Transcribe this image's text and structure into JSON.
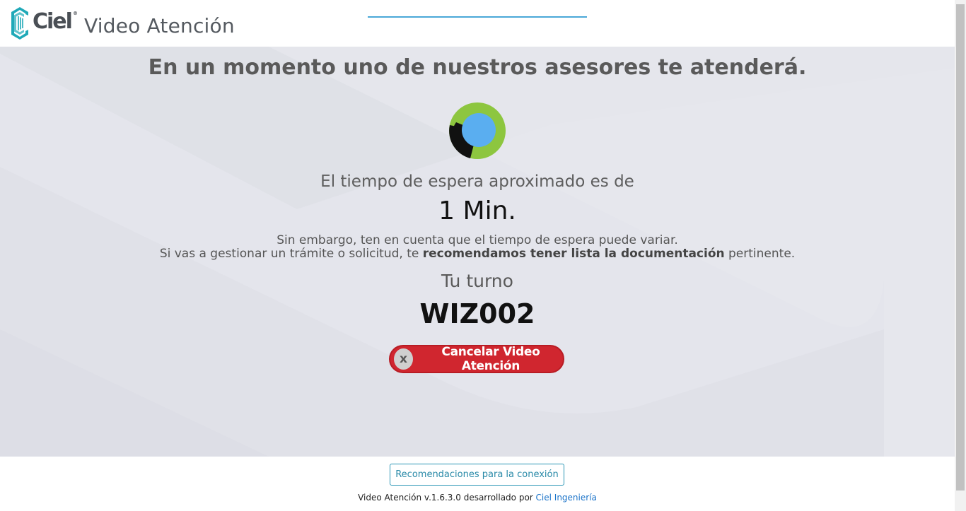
{
  "header": {
    "logo_text": "Ciel",
    "logo_reg": "®",
    "app_title": "Video Atención"
  },
  "main": {
    "headline": "En un momento uno de nuestros asesores te atenderá.",
    "spinner_icon": "loading-spinner-icon",
    "wait_label": "El tiempo de espera aproximado es de",
    "wait_value": "1 Min.",
    "note_line1": "Sin embargo, ten en cuenta que el tiempo de espera puede variar.",
    "note_line2_pre": "Si vas a gestionar un trámite o solicitud, te ",
    "note_line2_bold": "recomendamos tener lista la documentación",
    "note_line2_post": " pertinente.",
    "turn_label": "Tu turno",
    "turn_value": "WIZ002",
    "cancel_button": {
      "label": "Cancelar Video Atención",
      "icon_glyph": "x"
    }
  },
  "footer": {
    "recommendations_button": "Recomendaciones para la conexión",
    "credits_pre": "Video Atención v.1.6.3.0 desarrollado por ",
    "credits_link": "Ciel Ingeniería"
  },
  "colors": {
    "accent_blue": "#4aa8d8",
    "cancel_red": "#d0262f",
    "spinner_green": "#8dc63f",
    "spinner_blue": "#5aaef0",
    "logo_teal": "#1fa9b8"
  }
}
